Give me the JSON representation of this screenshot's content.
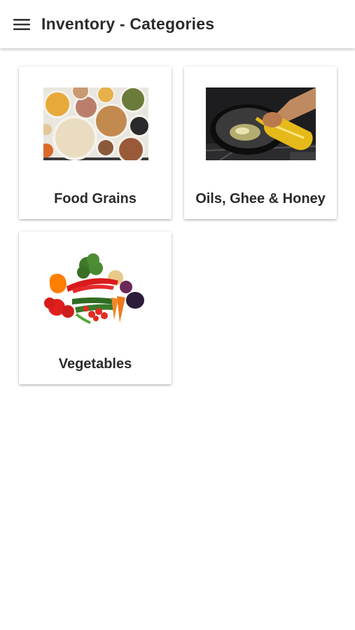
{
  "app_bar": {
    "title": "Inventory - Categories",
    "menu_icon": "hamburger-menu-icon",
    "background": "#ffffff"
  },
  "categories": [
    {
      "label": "Food Grains",
      "image": "food-grains-image"
    },
    {
      "label": "Oils, Ghee & Honey",
      "image": "oil-pan-image"
    },
    {
      "label": "Vegetables",
      "image": "vegetables-image"
    }
  ],
  "colors": {
    "text": "#2b2b2b",
    "card_background": "#ffffff",
    "page_background": "#ffffff"
  }
}
